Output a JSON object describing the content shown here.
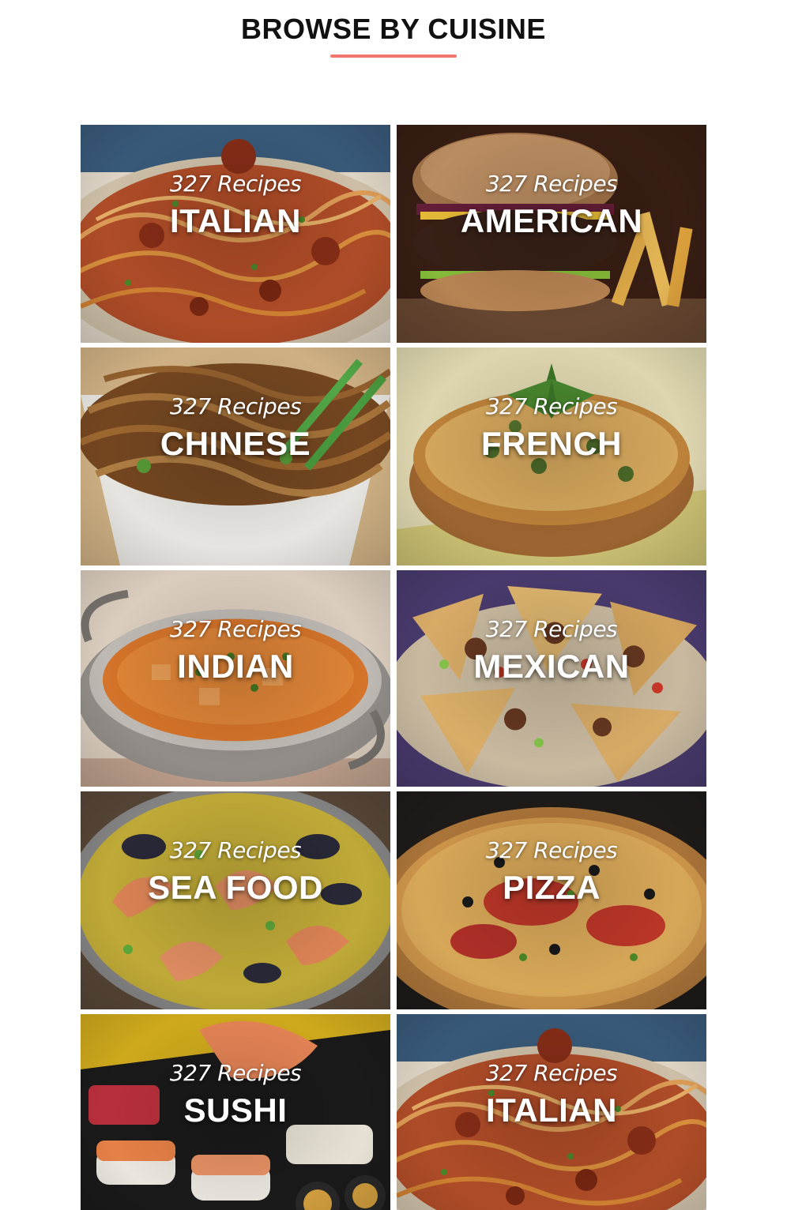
{
  "header": {
    "title": "BROWSE BY CUISINE",
    "accent_color": "#f0766d"
  },
  "cuisines": [
    {
      "name": "ITALIAN",
      "count": "327 Recipes",
      "image": "spaghetti-bolognese"
    },
    {
      "name": "AMERICAN",
      "count": "327 Recipes",
      "image": "burger-and-fries"
    },
    {
      "name": "CHINESE",
      "count": "327 Recipes",
      "image": "noodles-bowl"
    },
    {
      "name": "FRENCH",
      "count": "327 Recipes",
      "image": "quiche"
    },
    {
      "name": "INDIAN",
      "count": "327 Recipes",
      "image": "curry-pot"
    },
    {
      "name": "MEXICAN",
      "count": "327 Recipes",
      "image": "nachos"
    },
    {
      "name": "SEA FOOD",
      "count": "327 Recipes",
      "image": "paella-prawns"
    },
    {
      "name": "PIZZA",
      "count": "327 Recipes",
      "image": "pizza"
    },
    {
      "name": "SUSHI",
      "count": "327 Recipes",
      "image": "sushi-platter"
    },
    {
      "name": "ITALIAN",
      "count": "327 Recipes",
      "image": "spaghetti-bolognese"
    }
  ]
}
